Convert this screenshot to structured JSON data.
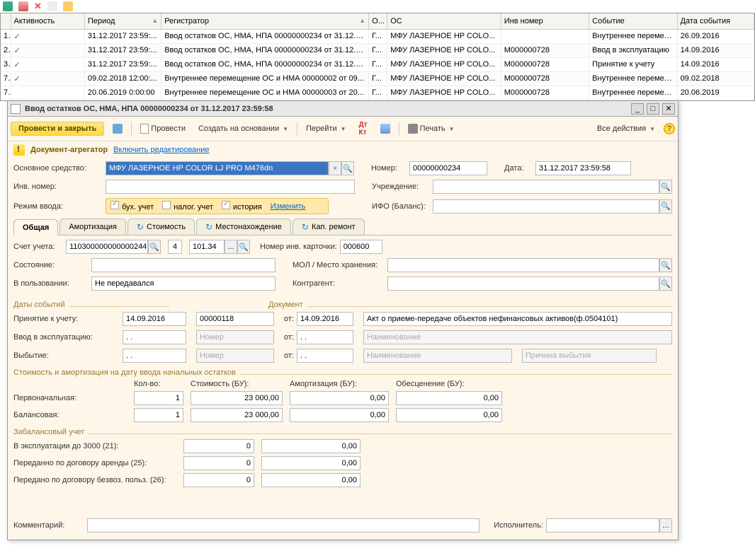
{
  "toolbar_icons": [
    "icon1",
    "icon2",
    "icon3",
    "icon4",
    "icon5"
  ],
  "grid": {
    "headers": [
      "",
      "Активность",
      "Период",
      "Регистратор",
      "О...",
      "ОС",
      "Инв номер",
      "Событие",
      "Дата события"
    ],
    "rows": [
      {
        "num": "1",
        "active": "✓",
        "period": "31.12.2017 23:59:...",
        "reg": "Ввод остатков ОС, НМА, НПА 00000000234 от 31.12.2...",
        "o": "Г...",
        "os": "МФУ ЛАЗЕРНОЕ HP COLO...",
        "inv": "",
        "event": "Внутреннее перемещение",
        "date": "26.09.2016"
      },
      {
        "num": "2",
        "active": "✓",
        "period": "31.12.2017 23:59:...",
        "reg": "Ввод остатков ОС, НМА, НПА 00000000234 от 31.12.2...",
        "o": "Г...",
        "os": "МФУ ЛАЗЕРНОЕ HP COLO...",
        "inv": "М000000728",
        "event": "Ввод в эксплуатацию",
        "date": "14.09.2016"
      },
      {
        "num": "3",
        "active": "✓",
        "period": "31.12.2017 23:59:...",
        "reg": "Ввод остатков ОС, НМА, НПА 00000000234 от 31.12.2...",
        "o": "Г...",
        "os": "МФУ ЛАЗЕРНОЕ HP COLO...",
        "inv": "М000000728",
        "event": "Принятие к учету",
        "date": "14.09.2016"
      },
      {
        "num": "7",
        "active": "✓",
        "period": "09.02.2018 12:00:...",
        "reg": "Внутреннее перемещение ОС и НМА 00000002 от 09...",
        "o": "Г...",
        "os": "МФУ ЛАЗЕРНОЕ HP COLO...",
        "inv": "М000000728",
        "event": "Внутреннее перемещение",
        "date": "09.02.2018"
      },
      {
        "num": "7",
        "active": "",
        "period": "20.06.2019 0:00:00",
        "reg": "Внутреннее перемещение ОС и НМА 00000003 от 20...",
        "o": "Г...",
        "os": "МФУ ЛАЗЕРНОЕ HP COLO...",
        "inv": "М000000728",
        "event": "Внутреннее перемещение",
        "date": "20.06.2019"
      }
    ]
  },
  "window": {
    "title": "Ввод остатков ОС, НМА, НПА 00000000234 от 31.12.2017 23:59:58",
    "toolbar": {
      "submit_close": "Провести и закрыть",
      "submit": "Провести",
      "create_from": "Создать на основании",
      "goto": "Перейти",
      "print": "Печать",
      "all_actions": "Все действия"
    },
    "warn": {
      "label": "Документ-агрегатор",
      "link": "Включить редактирование"
    },
    "fields": {
      "os_label": "Основное средство:",
      "os_value": "МФУ ЛАЗЕРНОЕ HP COLOR LJ PRO M476dn",
      "number_label": "Номер:",
      "number_value": "00000000234",
      "date_label": "Дата:",
      "date_value": "31.12.2017 23:59:58",
      "inv_label": "Инв. номер:",
      "inv_value": "",
      "org_label": "Учреждение:",
      "org_value": "",
      "mode_label": "Режим ввода:",
      "mode_bu": "бух. учет",
      "mode_nu": "налог. учет",
      "mode_hist": "история",
      "mode_change": "Изменить",
      "ifo_label": "ИФО (Баланс):",
      "ifo_value": ""
    },
    "tabs": [
      "Общая",
      "Амортизация",
      "Стоимость",
      "Местонахождение",
      "Кап. ремонт"
    ],
    "general": {
      "account_label": "Счет учета:",
      "account": "110300000000000244",
      "acc2": "4",
      "acc3": "101.34",
      "inv_card_label": "Номер инв. карточки:",
      "inv_card": "000600",
      "state_label": "Состояние:",
      "mol_label": "МОЛ / Место хранения:",
      "inuse_label": "В пользовании:",
      "inuse": "Не передавался",
      "contr_label": "Контрагент:",
      "dates_section": "Даты событий",
      "doc_section": "Документ",
      "accept_label": "Принятие к учету:",
      "accept_date": "14.09.2016",
      "doc_num": "00000118",
      "from_label": "от:",
      "doc_date": "14.09.2016",
      "doc_name": "Акт о приеме-передаче объектов нефинансовых активов(ф.0504101)",
      "commission_label": "Ввод в эксплуатацию:",
      "comm_date": ". .",
      "num_ph": "Номер",
      "name_ph": "Наименование",
      "disposal_label": "Выбытие:",
      "disp_date": ". .",
      "reason_ph": "Причина выбытия",
      "amort_section": "Стоимость и амортизация на дату ввода начальных остатков",
      "qty": "Кол-во:",
      "cost_bu": "Стоимость (БУ):",
      "amort_bu": "Амортизация (БУ):",
      "impair_bu": "Обесценение (БУ):",
      "initial": "Первоначальная:",
      "balance": "Балансовая:",
      "initial_qty": "1",
      "initial_cost": "23 000,00",
      "initial_amort": "0,00",
      "initial_impair": "0,00",
      "balance_qty": "1",
      "balance_cost": "23 000,00",
      "balance_amort": "0,00",
      "balance_impair": "0,00",
      "offbal_section": "Забалансовый учет",
      "inexp": "В эксплуатации до 3000 (21):",
      "rent": "Переданно по договору аренды (25):",
      "free": "Передано по договору безвоз. польз. (26):",
      "zero": "0",
      "zero00": "0,00",
      "comment_label": "Комментарий:",
      "executor_label": "Исполнитель:"
    }
  }
}
